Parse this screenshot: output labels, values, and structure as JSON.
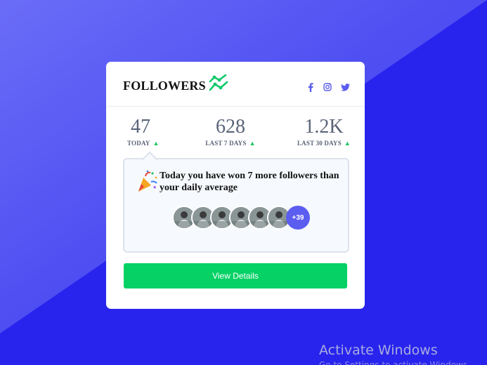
{
  "card": {
    "title": "FOLLOWERS",
    "icons": {
      "trend": "trend-line-icon",
      "facebook": "facebook-icon",
      "instagram": "instagram-icon",
      "twitter": "twitter-icon"
    },
    "colors": {
      "accent_green": "#05d165",
      "brand_blue": "#5b5cf0",
      "text_gray": "#5a6478"
    }
  },
  "stats": [
    {
      "value": "47",
      "label": "TODAY"
    },
    {
      "value": "628",
      "label": "LAST 7 DAYS"
    },
    {
      "value": "1.2K",
      "label": "LAST 30 DAYS"
    }
  ],
  "panel": {
    "message": "Today you have won 7 more followers than your daily average",
    "extra_count": "+39",
    "avatar_count": 6
  },
  "button": {
    "label": "View Details"
  },
  "watermark": {
    "line1": "Activate Windows",
    "line2": "Go to Settings to activate Windows."
  }
}
